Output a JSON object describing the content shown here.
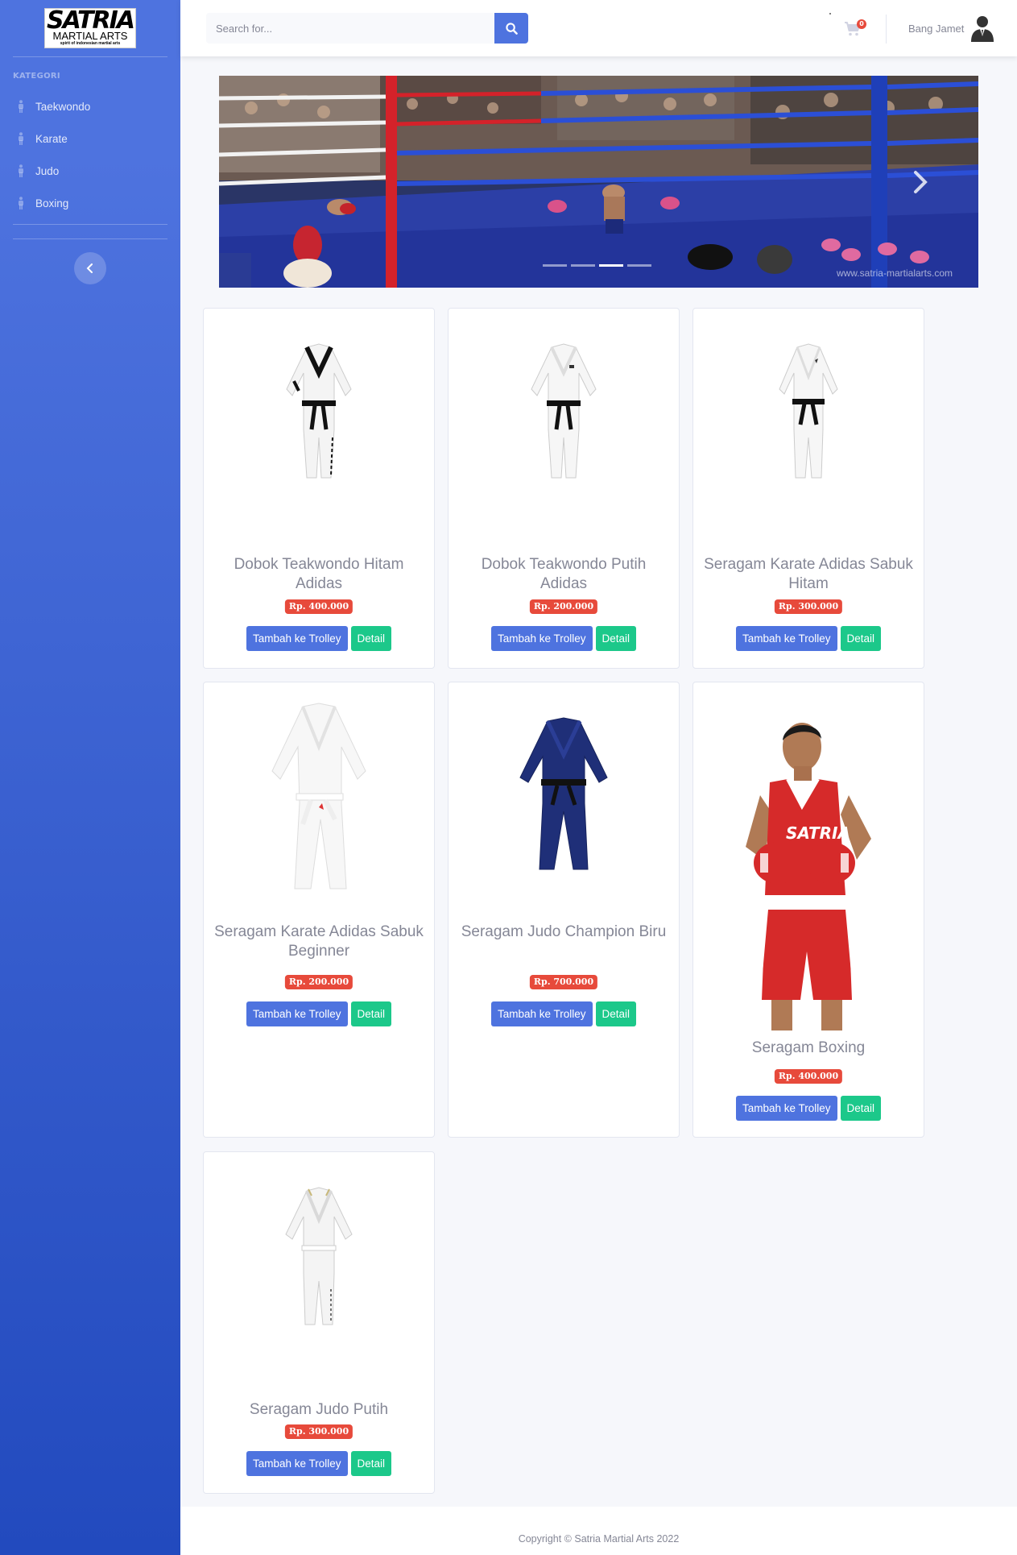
{
  "brand": {
    "logo_main": "SATRIA",
    "logo_sub": "MARTIAL ARTS",
    "logo_tag": "spirit of indonesian martial arts"
  },
  "sidebar": {
    "heading": "KATEGORI",
    "items": [
      {
        "label": "Taekwondo",
        "icon": "person-icon"
      },
      {
        "label": "Karate",
        "icon": "person-icon"
      },
      {
        "label": "Judo",
        "icon": "person-icon"
      },
      {
        "label": "Boxing",
        "icon": "person-icon"
      }
    ],
    "toggle_icon": "chevron-left-icon"
  },
  "topbar": {
    "search": {
      "placeholder": "Search for...",
      "value": "",
      "button_icon": "search-icon"
    },
    "cart": {
      "icon": "shopping-cart-icon",
      "count": "0"
    },
    "user": {
      "name": "Bang Jamet",
      "avatar_icon": "user-avatar-icon"
    }
  },
  "carousel": {
    "slide_count": 4,
    "active_index": 2,
    "watermark": "www.satria-martialarts.com",
    "next_icon": "chevron-right-icon"
  },
  "products": [
    {
      "name": "Dobok Teakwondo Hitam Adidas",
      "price": "Rp. 400.000",
      "add_label": "Tambah ke Trolley",
      "detail_label": "Detail"
    },
    {
      "name": "Dobok Teakwondo Putih Adidas",
      "price": "Rp. 200.000",
      "add_label": "Tambah ke Trolley",
      "detail_label": "Detail"
    },
    {
      "name": "Seragam Karate Adidas Sabuk Hitam",
      "price": "Rp. 300.000",
      "add_label": "Tambah ke Trolley",
      "detail_label": "Detail"
    },
    {
      "name": "Seragam Karate Adidas Sabuk Beginner",
      "price": "Rp. 200.000",
      "add_label": "Tambah ke Trolley",
      "detail_label": "Detail"
    },
    {
      "name": "Seragam Judo Champion Biru",
      "price": "Rp. 700.000",
      "add_label": "Tambah ke Trolley",
      "detail_label": "Detail"
    },
    {
      "name": "Seragam Boxing",
      "price": "Rp. 400.000",
      "add_label": "Tambah ke Trolley",
      "detail_label": "Detail"
    },
    {
      "name": "Seragam Judo Putih",
      "price": "Rp. 300.000",
      "add_label": "Tambah ke Trolley",
      "detail_label": "Detail"
    }
  ],
  "footer": {
    "copyright": "Copyright © Satria Martial Arts 2022"
  },
  "colors": {
    "primary": "#4e73df",
    "success": "#1cc88a",
    "danger": "#e74a3b",
    "sidebar_start": "#4e73df",
    "sidebar_end": "#224abe"
  }
}
